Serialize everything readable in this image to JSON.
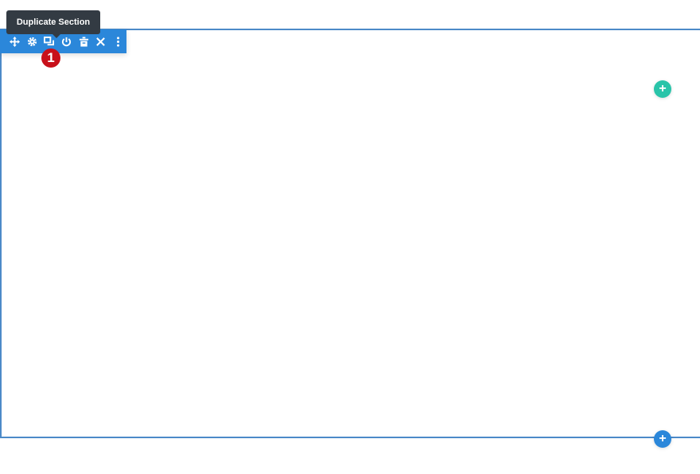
{
  "tooltip": {
    "text": "Duplicate Section"
  },
  "toolbar": {
    "color": "#2b87da",
    "buttons": [
      {
        "name": "move-icon",
        "label": "Move"
      },
      {
        "name": "gear-icon",
        "label": "Settings"
      },
      {
        "name": "duplicate-icon",
        "label": "Duplicate Section"
      },
      {
        "name": "power-icon",
        "label": "Disable"
      },
      {
        "name": "trash-icon",
        "label": "Delete"
      },
      {
        "name": "close-icon",
        "label": "Close"
      },
      {
        "name": "more-icon",
        "label": "More"
      }
    ]
  },
  "annotation": {
    "number": "1",
    "color": "#c8101a"
  },
  "add_row_button": {
    "symbol": "+",
    "color": "#29c4a9"
  },
  "add_section_button": {
    "symbol": "+",
    "color": "#2b87da"
  }
}
